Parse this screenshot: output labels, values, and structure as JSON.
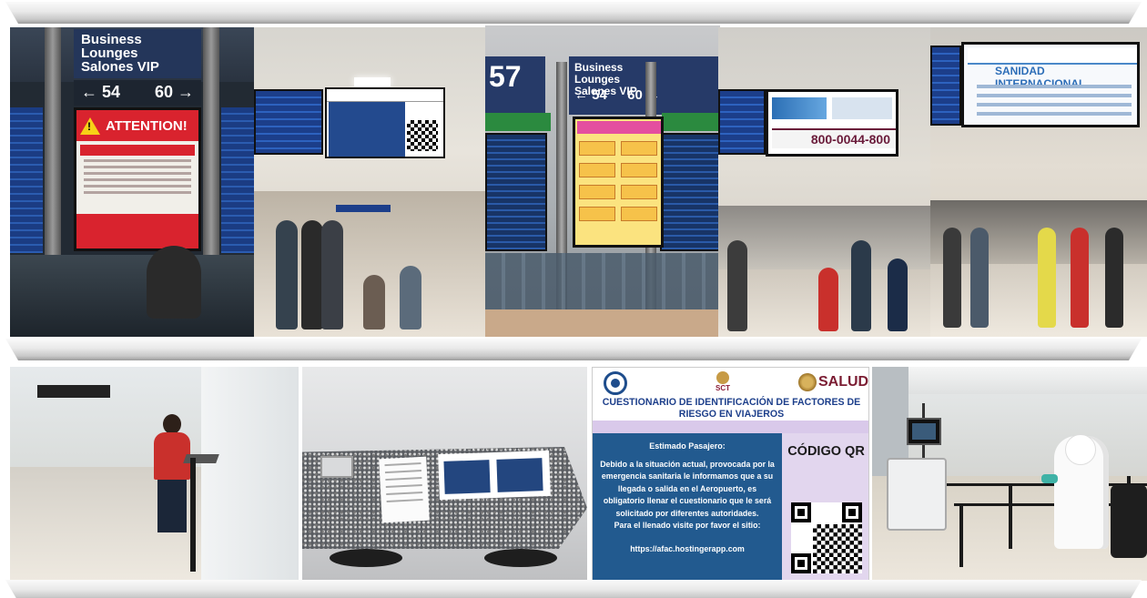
{
  "photo1": {
    "lounge_line1": "Business Lounges",
    "lounge_line2": "Salones VIP",
    "arrow_left": "← 54",
    "arrow_right": "60 →",
    "attention": "ATTENTION!"
  },
  "photo3": {
    "gate": "57",
    "lounge_line1": "Business Lounges",
    "lounge_line2": "Salones VIP",
    "arrow_left": "← 54",
    "arrow_right": "60 →"
  },
  "photo4": {
    "phone": "800-0044-800"
  },
  "photo5": {
    "title": "SANIDAD INTERNACIONAL"
  },
  "poster": {
    "sct_label": "SCT",
    "salud_label": "SALUD",
    "title": "CUESTIONARIO DE IDENTIFICACIÓN DE FACTORES DE RIESGO EN VIAJEROS",
    "greeting": "Estimado Pasajero:",
    "body": "Debido a la situación actual, provocada por la emergencia sanitaria le informamos que a su llegada o salida en el Aeropuerto, es obligatorio llenar el cuestionario que le será solicitado por diferentes autoridades.",
    "visit": "Para el llenado visite por favor el sitio:",
    "url": "https://afac.hostingerapp.com",
    "qr_label": "CÓDIGO QR"
  },
  "colors": {
    "poster_blue": "#225a8f",
    "poster_lilac": "#e2d6ee",
    "salud_maroon": "#7b1d33",
    "attention_red": "#d9232e"
  }
}
